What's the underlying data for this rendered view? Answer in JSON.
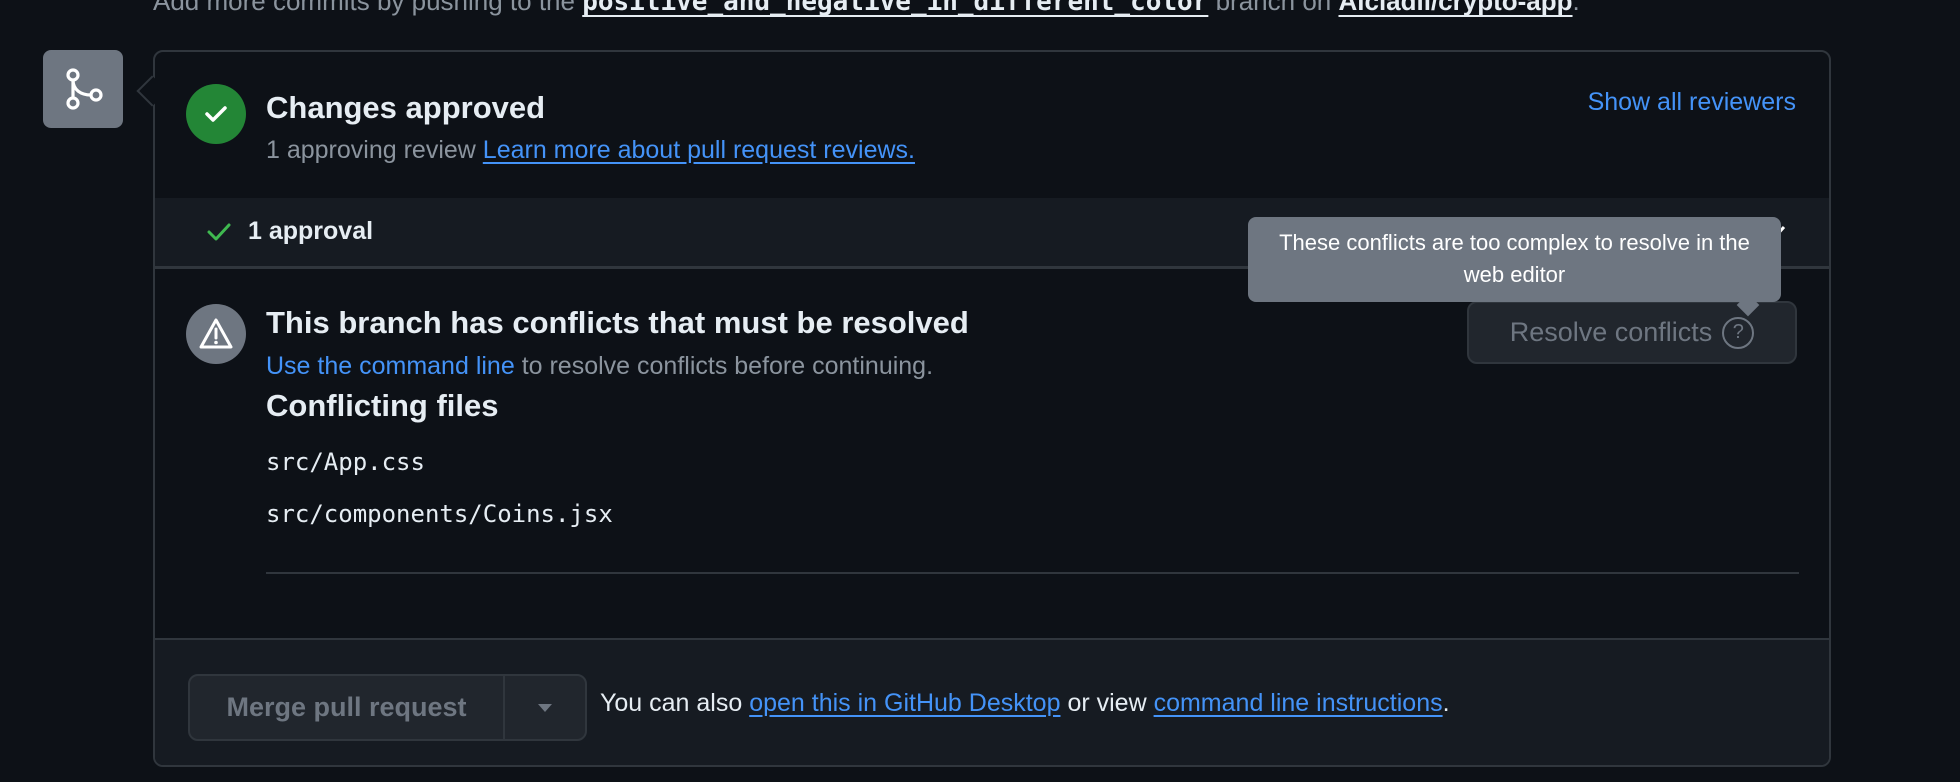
{
  "top_line": {
    "prefix": "Add more commits by pushing to the",
    "branch": "positive_and_negative_in_different_color",
    "middle": "branch on",
    "repo": "Alcladil/crypto-app",
    "suffix": "."
  },
  "review": {
    "title": "Changes approved",
    "count_text": "1 approving review",
    "learn_more_link": "Learn more about pull request reviews.",
    "show_all_link": "Show all reviewers",
    "approval_label": "1 approval"
  },
  "conflicts": {
    "title": "This branch has conflicts that must be resolved",
    "cmd_link": "Use the command line",
    "cmd_suffix": "to resolve conflicts before continuing.",
    "files_heading": "Conflicting files",
    "files": [
      "src/App.css",
      "src/components/Coins.jsx"
    ],
    "resolve_button": "Resolve conflicts",
    "help_glyph": "?",
    "tooltip": "These conflicts are too complex to resolve in the web editor"
  },
  "footer": {
    "merge_button": "Merge pull request",
    "text_prefix": "You can also",
    "desktop_link": "open this in GitHub Desktop",
    "text_middle": "or view",
    "cli_link": "command line instructions",
    "text_suffix": "."
  },
  "colors": {
    "background": "#0d1117",
    "success": "#238636",
    "link": "#4493f8",
    "muted": "#8b949e",
    "border": "#30363d"
  },
  "icons": [
    "git-merge-icon",
    "check-icon",
    "alert-icon",
    "question-icon",
    "triangle-down-icon"
  ]
}
